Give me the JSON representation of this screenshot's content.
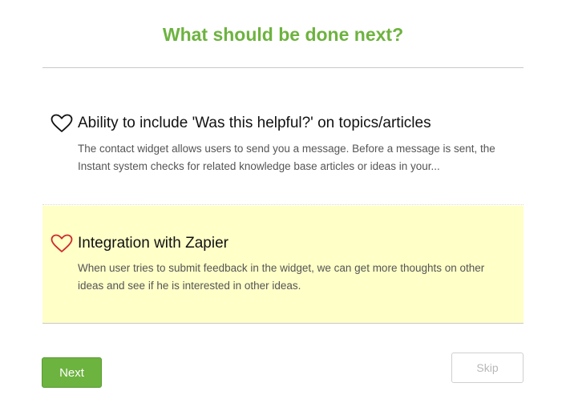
{
  "header": {
    "title": "What should be done next?"
  },
  "ideas": [
    {
      "title": "Ability to include 'Was this helpful?' on topics/articles",
      "description": "The contact widget allows users to send you a message. Before a message is sent, the Instant system checks for related knowledge base articles or ideas in your...",
      "icon": "heart-outline-icon",
      "icon_color": "#111111",
      "highlighted": false
    },
    {
      "title": "Integration with Zapier",
      "description": "When user tries to submit feedback in the widget, we can get more thoughts on other ideas and see if he is interested in other ideas.",
      "icon": "heart-outline-icon",
      "icon_color": "#cc2b2b",
      "highlighted": true,
      "highlight_color": "#ffffc8"
    }
  ],
  "actions": {
    "next_label": "Next",
    "skip_label": "Skip"
  },
  "colors": {
    "accent": "#6db33f",
    "title": "#6db33f"
  }
}
